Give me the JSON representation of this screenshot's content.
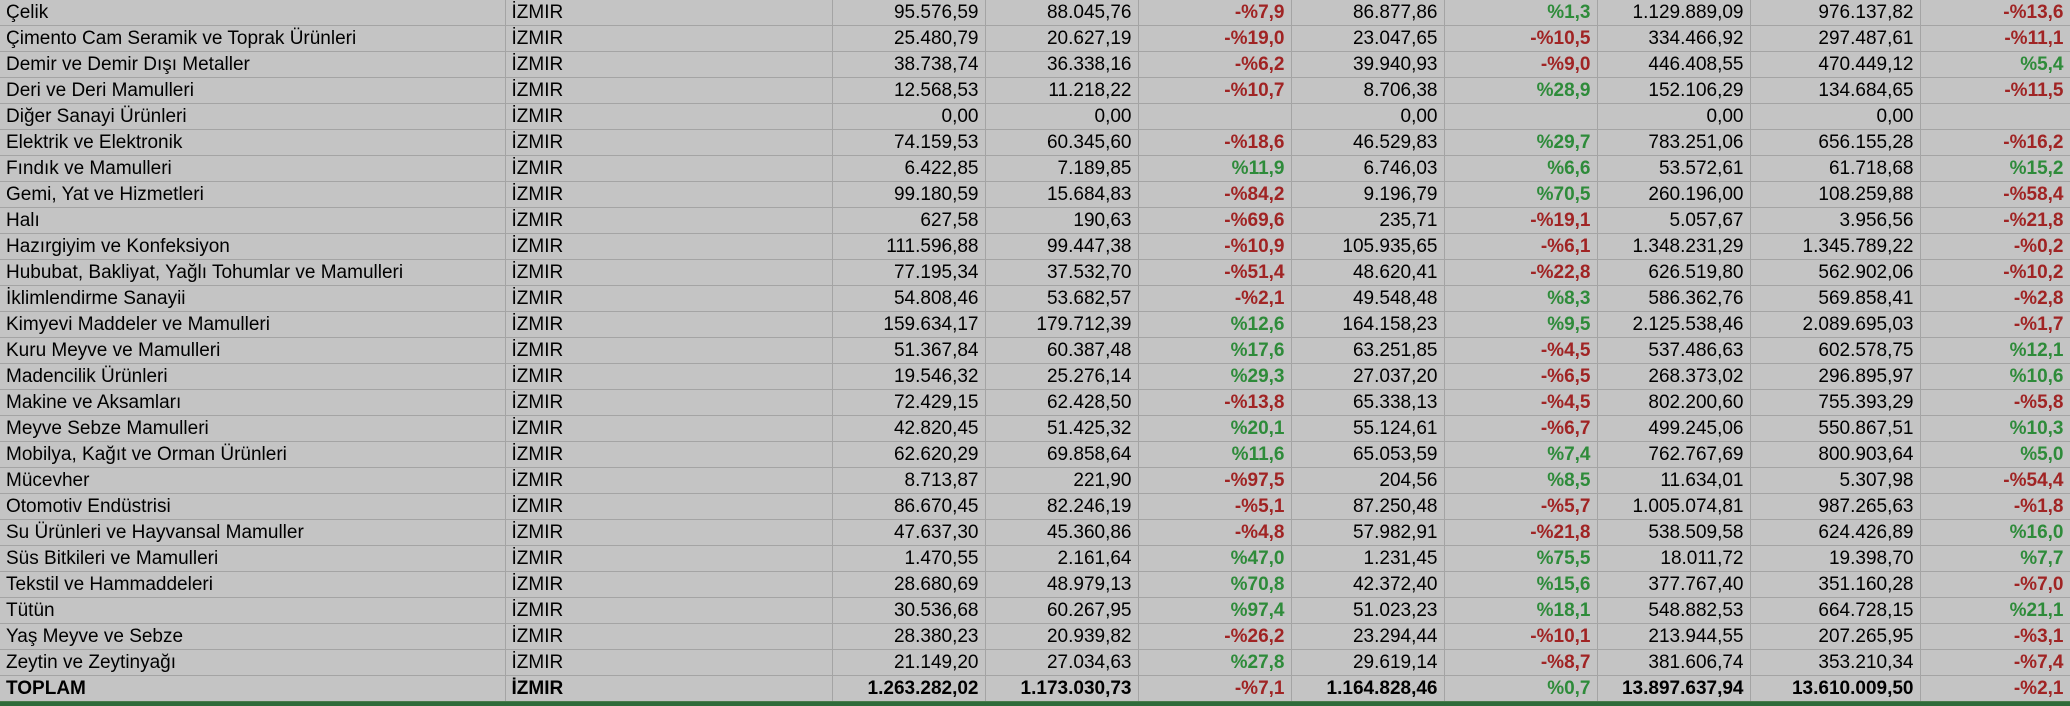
{
  "rows": [
    {
      "sector": "Çelik",
      "city": "İZMIR",
      "v1": "95.576,59",
      "v2": "88.045,76",
      "p1": "-%7,9",
      "v3": "86.877,86",
      "p2": "%1,3",
      "v4": "1.129.889,09",
      "v5": "976.137,82",
      "p3": "-%13,6"
    },
    {
      "sector": "Çimento Cam Seramik ve Toprak Ürünleri",
      "city": "İZMIR",
      "v1": "25.480,79",
      "v2": "20.627,19",
      "p1": "-%19,0",
      "v3": "23.047,65",
      "p2": "-%10,5",
      "v4": "334.466,92",
      "v5": "297.487,61",
      "p3": "-%11,1"
    },
    {
      "sector": "Demir ve Demir Dışı Metaller",
      "city": "İZMIR",
      "v1": "38.738,74",
      "v2": "36.338,16",
      "p1": "-%6,2",
      "v3": "39.940,93",
      "p2": "-%9,0",
      "v4": "446.408,55",
      "v5": "470.449,12",
      "p3": "%5,4"
    },
    {
      "sector": "Deri ve Deri Mamulleri",
      "city": "İZMIR",
      "v1": "12.568,53",
      "v2": "11.218,22",
      "p1": "-%10,7",
      "v3": "8.706,38",
      "p2": "%28,9",
      "v4": "152.106,29",
      "v5": "134.684,65",
      "p3": "-%11,5"
    },
    {
      "sector": "Diğer Sanayi Ürünleri",
      "city": "İZMIR",
      "v1": "0,00",
      "v2": "0,00",
      "p1": "",
      "v3": "0,00",
      "p2": "",
      "v4": "0,00",
      "v5": "0,00",
      "p3": ""
    },
    {
      "sector": "Elektrik ve Elektronik",
      "city": "İZMIR",
      "v1": "74.159,53",
      "v2": "60.345,60",
      "p1": "-%18,6",
      "v3": "46.529,83",
      "p2": "%29,7",
      "v4": "783.251,06",
      "v5": "656.155,28",
      "p3": "-%16,2"
    },
    {
      "sector": "Fındık ve Mamulleri",
      "city": "İZMIR",
      "v1": "6.422,85",
      "v2": "7.189,85",
      "p1": "%11,9",
      "v3": "6.746,03",
      "p2": "%6,6",
      "v4": "53.572,61",
      "v5": "61.718,68",
      "p3": "%15,2"
    },
    {
      "sector": "Gemi, Yat ve Hizmetleri",
      "city": "İZMIR",
      "v1": "99.180,59",
      "v2": "15.684,83",
      "p1": "-%84,2",
      "v3": "9.196,79",
      "p2": "%70,5",
      "v4": "260.196,00",
      "v5": "108.259,88",
      "p3": "-%58,4"
    },
    {
      "sector": "Halı",
      "city": "İZMIR",
      "v1": "627,58",
      "v2": "190,63",
      "p1": "-%69,6",
      "v3": "235,71",
      "p2": "-%19,1",
      "v4": "5.057,67",
      "v5": "3.956,56",
      "p3": "-%21,8"
    },
    {
      "sector": "Hazırgiyim ve Konfeksiyon",
      "city": "İZMIR",
      "v1": "111.596,88",
      "v2": "99.447,38",
      "p1": "-%10,9",
      "v3": "105.935,65",
      "p2": "-%6,1",
      "v4": "1.348.231,29",
      "v5": "1.345.789,22",
      "p3": "-%0,2"
    },
    {
      "sector": "Hububat, Bakliyat, Yağlı Tohumlar ve Mamulleri",
      "city": "İZMIR",
      "v1": "77.195,34",
      "v2": "37.532,70",
      "p1": "-%51,4",
      "v3": "48.620,41",
      "p2": "-%22,8",
      "v4": "626.519,80",
      "v5": "562.902,06",
      "p3": "-%10,2"
    },
    {
      "sector": "İklimlendirme Sanayii",
      "city": "İZMIR",
      "v1": "54.808,46",
      "v2": "53.682,57",
      "p1": "-%2,1",
      "v3": "49.548,48",
      "p2": "%8,3",
      "v4": "586.362,76",
      "v5": "569.858,41",
      "p3": "-%2,8"
    },
    {
      "sector": "Kimyevi Maddeler ve Mamulleri",
      "city": "İZMIR",
      "v1": "159.634,17",
      "v2": "179.712,39",
      "p1": "%12,6",
      "v3": "164.158,23",
      "p2": "%9,5",
      "v4": "2.125.538,46",
      "v5": "2.089.695,03",
      "p3": "-%1,7"
    },
    {
      "sector": "Kuru Meyve ve Mamulleri",
      "city": "İZMIR",
      "v1": "51.367,84",
      "v2": "60.387,48",
      "p1": "%17,6",
      "v3": "63.251,85",
      "p2": "-%4,5",
      "v4": "537.486,63",
      "v5": "602.578,75",
      "p3": "%12,1"
    },
    {
      "sector": "Madencilik Ürünleri",
      "city": "İZMIR",
      "v1": "19.546,32",
      "v2": "25.276,14",
      "p1": "%29,3",
      "v3": "27.037,20",
      "p2": "-%6,5",
      "v4": "268.373,02",
      "v5": "296.895,97",
      "p3": "%10,6"
    },
    {
      "sector": "Makine ve Aksamları",
      "city": "İZMIR",
      "v1": "72.429,15",
      "v2": "62.428,50",
      "p1": "-%13,8",
      "v3": "65.338,13",
      "p2": "-%4,5",
      "v4": "802.200,60",
      "v5": "755.393,29",
      "p3": "-%5,8"
    },
    {
      "sector": "Meyve Sebze Mamulleri",
      "city": "İZMIR",
      "v1": "42.820,45",
      "v2": "51.425,32",
      "p1": "%20,1",
      "v3": "55.124,61",
      "p2": "-%6,7",
      "v4": "499.245,06",
      "v5": "550.867,51",
      "p3": "%10,3"
    },
    {
      "sector": "Mobilya, Kağıt ve Orman Ürünleri",
      "city": "İZMIR",
      "v1": "62.620,29",
      "v2": "69.858,64",
      "p1": "%11,6",
      "v3": "65.053,59",
      "p2": "%7,4",
      "v4": "762.767,69",
      "v5": "800.903,64",
      "p3": "%5,0"
    },
    {
      "sector": "Mücevher",
      "city": "İZMIR",
      "v1": "8.713,87",
      "v2": "221,90",
      "p1": "-%97,5",
      "v3": "204,56",
      "p2": "%8,5",
      "v4": "11.634,01",
      "v5": "5.307,98",
      "p3": "-%54,4"
    },
    {
      "sector": "Otomotiv Endüstrisi",
      "city": "İZMIR",
      "v1": "86.670,45",
      "v2": "82.246,19",
      "p1": "-%5,1",
      "v3": "87.250,48",
      "p2": "-%5,7",
      "v4": "1.005.074,81",
      "v5": "987.265,63",
      "p3": "-%1,8"
    },
    {
      "sector": "Su Ürünleri ve Hayvansal Mamuller",
      "city": "İZMIR",
      "v1": "47.637,30",
      "v2": "45.360,86",
      "p1": "-%4,8",
      "v3": "57.982,91",
      "p2": "-%21,8",
      "v4": "538.509,58",
      "v5": "624.426,89",
      "p3": "%16,0"
    },
    {
      "sector": "Süs Bitkileri ve Mamulleri",
      "city": "İZMIR",
      "v1": "1.470,55",
      "v2": "2.161,64",
      "p1": "%47,0",
      "v3": "1.231,45",
      "p2": "%75,5",
      "v4": "18.011,72",
      "v5": "19.398,70",
      "p3": "%7,7"
    },
    {
      "sector": "Tekstil ve Hammaddeleri",
      "city": "İZMIR",
      "v1": "28.680,69",
      "v2": "48.979,13",
      "p1": "%70,8",
      "v3": "42.372,40",
      "p2": "%15,6",
      "v4": "377.767,40",
      "v5": "351.160,28",
      "p3": "-%7,0"
    },
    {
      "sector": "Tütün",
      "city": "İZMIR",
      "v1": "30.536,68",
      "v2": "60.267,95",
      "p1": "%97,4",
      "v3": "51.023,23",
      "p2": "%18,1",
      "v4": "548.882,53",
      "v5": "664.728,15",
      "p3": "%21,1"
    },
    {
      "sector": "Yaş Meyve ve Sebze",
      "city": "İZMIR",
      "v1": "28.380,23",
      "v2": "20.939,82",
      "p1": "-%26,2",
      "v3": "23.294,44",
      "p2": "-%10,1",
      "v4": "213.944,55",
      "v5": "207.265,95",
      "p3": "-%3,1"
    },
    {
      "sector": "Zeytin ve Zeytinyağı",
      "city": "İZMIR",
      "v1": "21.149,20",
      "v2": "27.034,63",
      "p1": "%27,8",
      "v3": "29.619,14",
      "p2": "-%8,7",
      "v4": "381.606,74",
      "v5": "353.210,34",
      "p3": "-%7,4"
    }
  ],
  "total": {
    "sector": "TOPLAM",
    "city": "İZMIR",
    "v1": "1.263.282,02",
    "v2": "1.173.030,73",
    "p1": "-%7,1",
    "v3": "1.164.828,46",
    "p2": "%0,7",
    "v4": "13.897.637,94",
    "v5": "13.610.009,50",
    "p3": "-%2,1"
  },
  "colors": {
    "positive": "#2e8b3a",
    "negative": "#a02424",
    "background": "#c4c4c4"
  }
}
